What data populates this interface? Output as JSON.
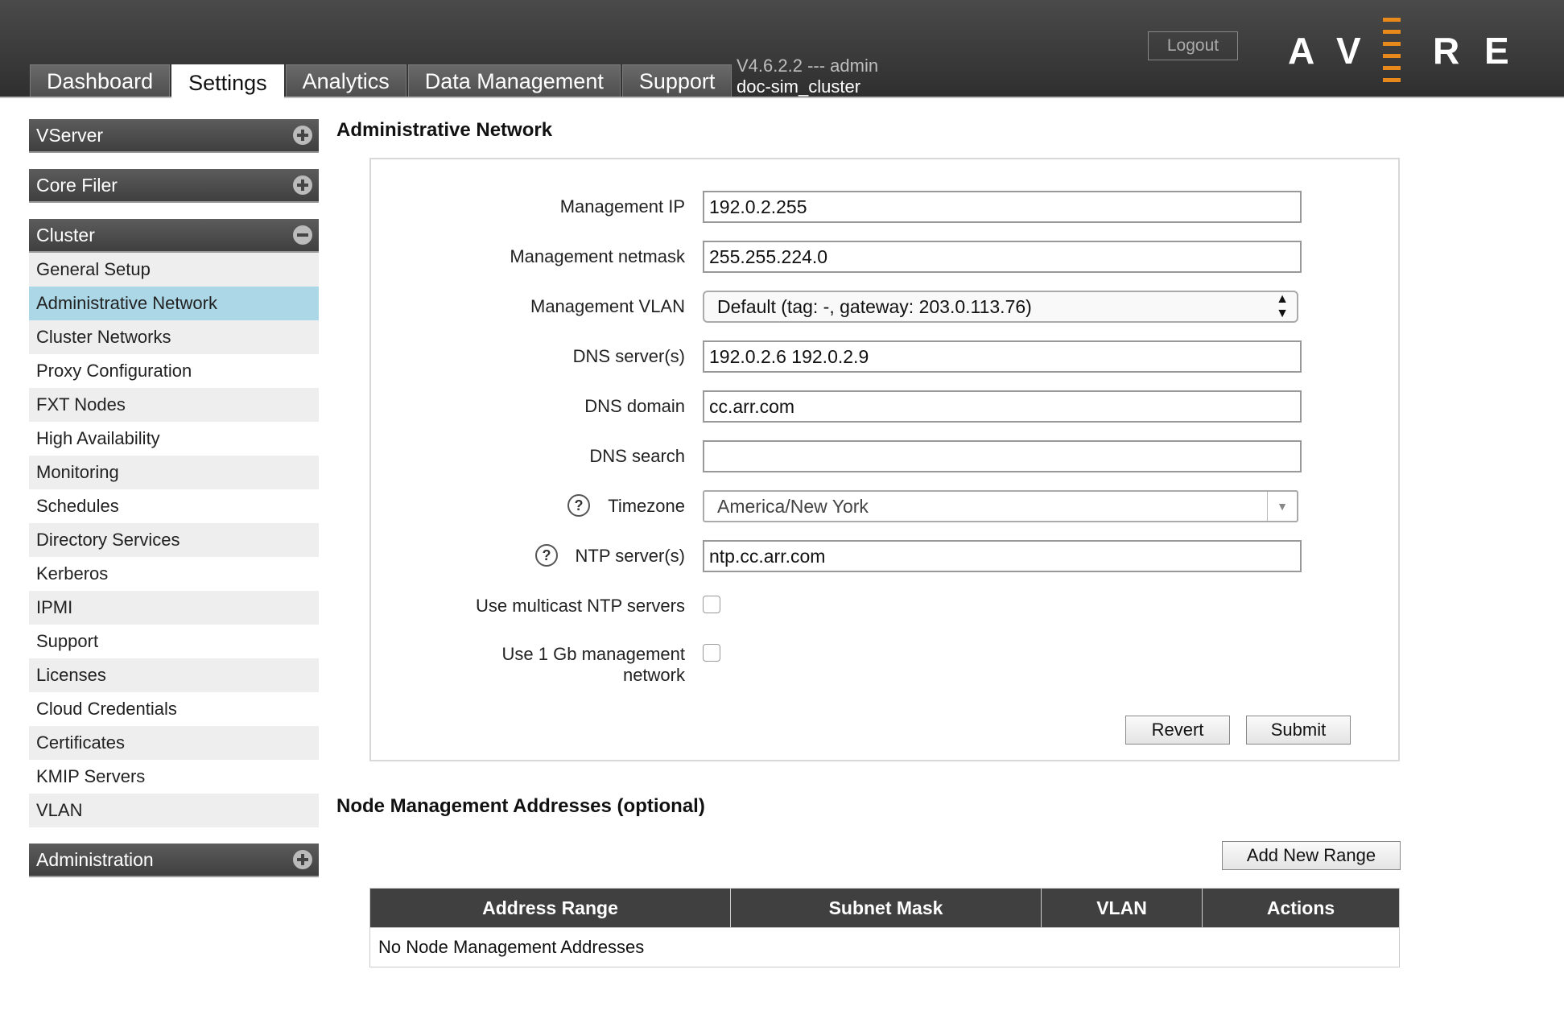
{
  "header": {
    "tabs": [
      "Dashboard",
      "Settings",
      "Analytics",
      "Data Management",
      "Support"
    ],
    "active_tab": "Settings",
    "version": "V4.6.2.2 --- admin",
    "cluster": "doc-sim_cluster",
    "logout_label": "Logout",
    "logo_letters": [
      "A",
      "V",
      "E",
      "R",
      "E"
    ],
    "logo_accent_color": "#e8891c"
  },
  "sidebar": {
    "vserver": "VServer",
    "core_filer": "Core Filer",
    "cluster": "Cluster",
    "items": [
      "General Setup",
      "Administrative Network",
      "Cluster Networks",
      "Proxy Configuration",
      "FXT Nodes",
      "High Availability",
      "Monitoring",
      "Schedules",
      "Directory Services",
      "Kerberos",
      "IPMI",
      "Support",
      "Licenses",
      "Cloud Credentials",
      "Certificates",
      "KMIP Servers",
      "VLAN"
    ],
    "selected": "Administrative Network",
    "administration": "Administration"
  },
  "admin": {
    "title": "Administrative Network",
    "labels": {
      "mgmt_ip": "Management IP",
      "netmask": "Management netmask",
      "vlan": "Management VLAN",
      "dns_servers": "DNS server(s)",
      "dns_domain": "DNS domain",
      "dns_search": "DNS search",
      "timezone": "Timezone",
      "ntp": "NTP server(s)",
      "multicast": "Use multicast NTP servers",
      "gb_mgmt_1": "Use 1 Gb management",
      "gb_mgmt_2": "network"
    },
    "values": {
      "mgmt_ip": "192.0.2.255",
      "netmask": "255.255.224.0",
      "vlan": "Default (tag: -, gateway: 203.0.113.76)",
      "dns_servers": "192.0.2.6 192.0.2.9",
      "dns_domain": "cc.arr.com",
      "dns_search": "",
      "timezone": "America/New York",
      "ntp": "ntp.cc.arr.com"
    },
    "help_glyph": "?",
    "revert": "Revert",
    "submit": "Submit"
  },
  "node_mgmt": {
    "title": "Node Management Addresses (optional)",
    "add_button": "Add New Range",
    "columns": [
      "Address Range",
      "Subnet Mask",
      "VLAN",
      "Actions"
    ],
    "empty": "No Node Management Addresses"
  }
}
